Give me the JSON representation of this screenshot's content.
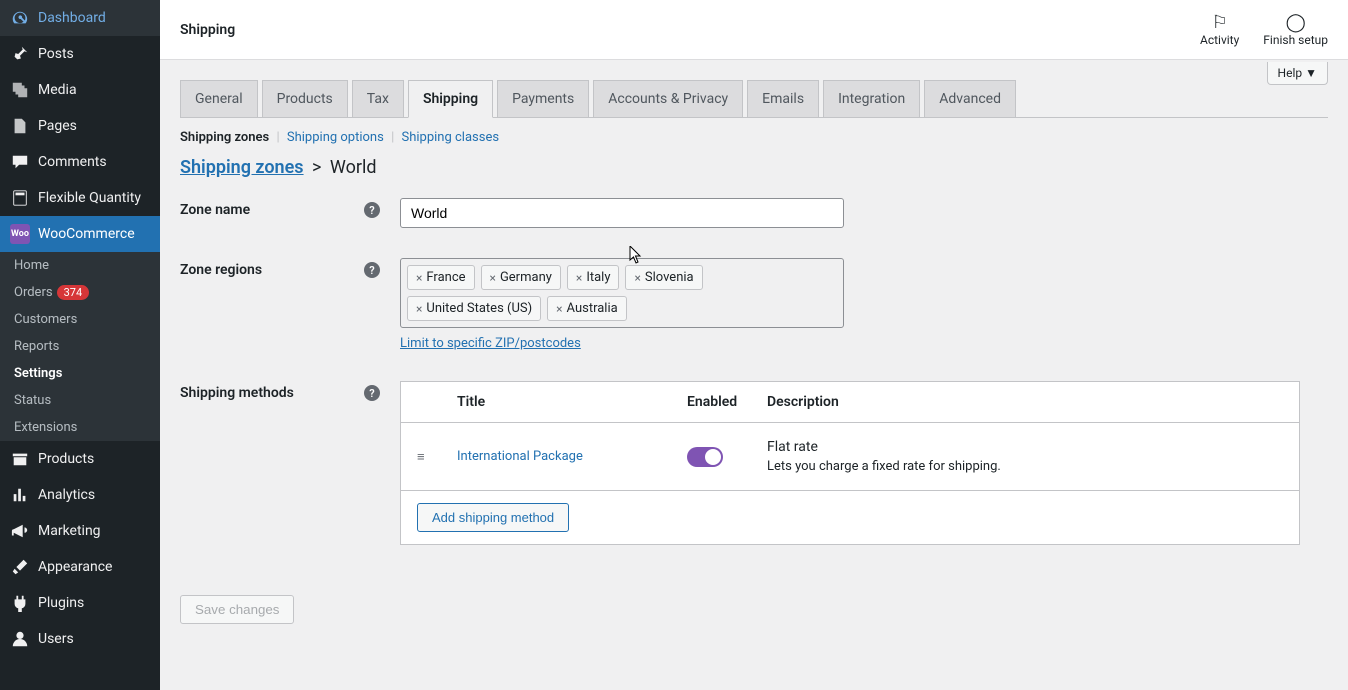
{
  "sidebar": {
    "items": [
      {
        "label": "Dashboard",
        "icon": "dashboard"
      },
      {
        "label": "Posts",
        "icon": "pin"
      },
      {
        "label": "Media",
        "icon": "media"
      },
      {
        "label": "Pages",
        "icon": "page"
      },
      {
        "label": "Comments",
        "icon": "comment"
      },
      {
        "label": "Flexible Quantity",
        "icon": "calc"
      },
      {
        "label": "WooCommerce",
        "icon": "woo",
        "active": true
      },
      {
        "label": "Products",
        "icon": "archive"
      },
      {
        "label": "Analytics",
        "icon": "chart"
      },
      {
        "label": "Marketing",
        "icon": "megaphone"
      },
      {
        "label": "Appearance",
        "icon": "brush"
      },
      {
        "label": "Plugins",
        "icon": "plug"
      },
      {
        "label": "Users",
        "icon": "user"
      }
    ],
    "woo_submenu": [
      {
        "label": "Home"
      },
      {
        "label": "Orders",
        "badge": "374"
      },
      {
        "label": "Customers"
      },
      {
        "label": "Reports"
      },
      {
        "label": "Settings",
        "active": true
      },
      {
        "label": "Status"
      },
      {
        "label": "Extensions"
      }
    ]
  },
  "topbar": {
    "title": "Shipping",
    "activity": "Activity",
    "finish_setup": "Finish setup",
    "help": "Help"
  },
  "tabs": [
    "General",
    "Products",
    "Tax",
    "Shipping",
    "Payments",
    "Accounts & Privacy",
    "Emails",
    "Integration",
    "Advanced"
  ],
  "active_tab": 3,
  "subnav": [
    {
      "label": "Shipping zones",
      "active": true
    },
    {
      "label": "Shipping options"
    },
    {
      "label": "Shipping classes"
    }
  ],
  "breadcrumb": {
    "link": "Shipping zones",
    "current": "World"
  },
  "form": {
    "zone_name_label": "Zone name",
    "zone_name_value": "World",
    "zone_regions_label": "Zone regions",
    "zone_regions": [
      "France",
      "Germany",
      "Italy",
      "Slovenia",
      "United States (US)",
      "Australia"
    ],
    "zip_link": "Limit to specific ZIP/postcodes",
    "methods_label": "Shipping methods",
    "table": {
      "headers": {
        "title": "Title",
        "enabled": "Enabled",
        "description": "Description"
      },
      "rows": [
        {
          "title": "International Package",
          "enabled": true,
          "desc_title": "Flat rate",
          "desc_sub": "Lets you charge a fixed rate for shipping."
        }
      ],
      "add_btn": "Add shipping method"
    },
    "save_btn": "Save changes"
  }
}
